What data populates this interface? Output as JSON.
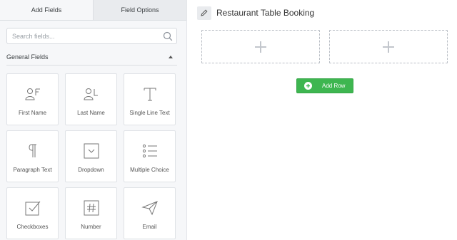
{
  "tabs": [
    {
      "label": "Add Fields"
    },
    {
      "label": "Field Options"
    }
  ],
  "search": {
    "placeholder": "Search fields..."
  },
  "section": {
    "title": "General Fields"
  },
  "fields": [
    {
      "label": "First Name",
      "icon": "first-name-icon"
    },
    {
      "label": "Last Name",
      "icon": "last-name-icon"
    },
    {
      "label": "Single Line Text",
      "icon": "text-t-icon"
    },
    {
      "label": "Paragraph Text",
      "icon": "paragraph-icon"
    },
    {
      "label": "Dropdown",
      "icon": "dropdown-icon"
    },
    {
      "label": "Multiple Choice",
      "icon": "list-icon"
    },
    {
      "label": "Checkboxes",
      "icon": "checkbox-icon"
    },
    {
      "label": "Number",
      "icon": "hash-icon"
    },
    {
      "label": "Email",
      "icon": "paper-plane-icon"
    }
  ],
  "form": {
    "title": "Restaurant Table Booking"
  },
  "add_row": {
    "label": "Add Row"
  },
  "colors": {
    "accent_green": "#3eb650",
    "panel_bg": "#f6f7f9"
  }
}
